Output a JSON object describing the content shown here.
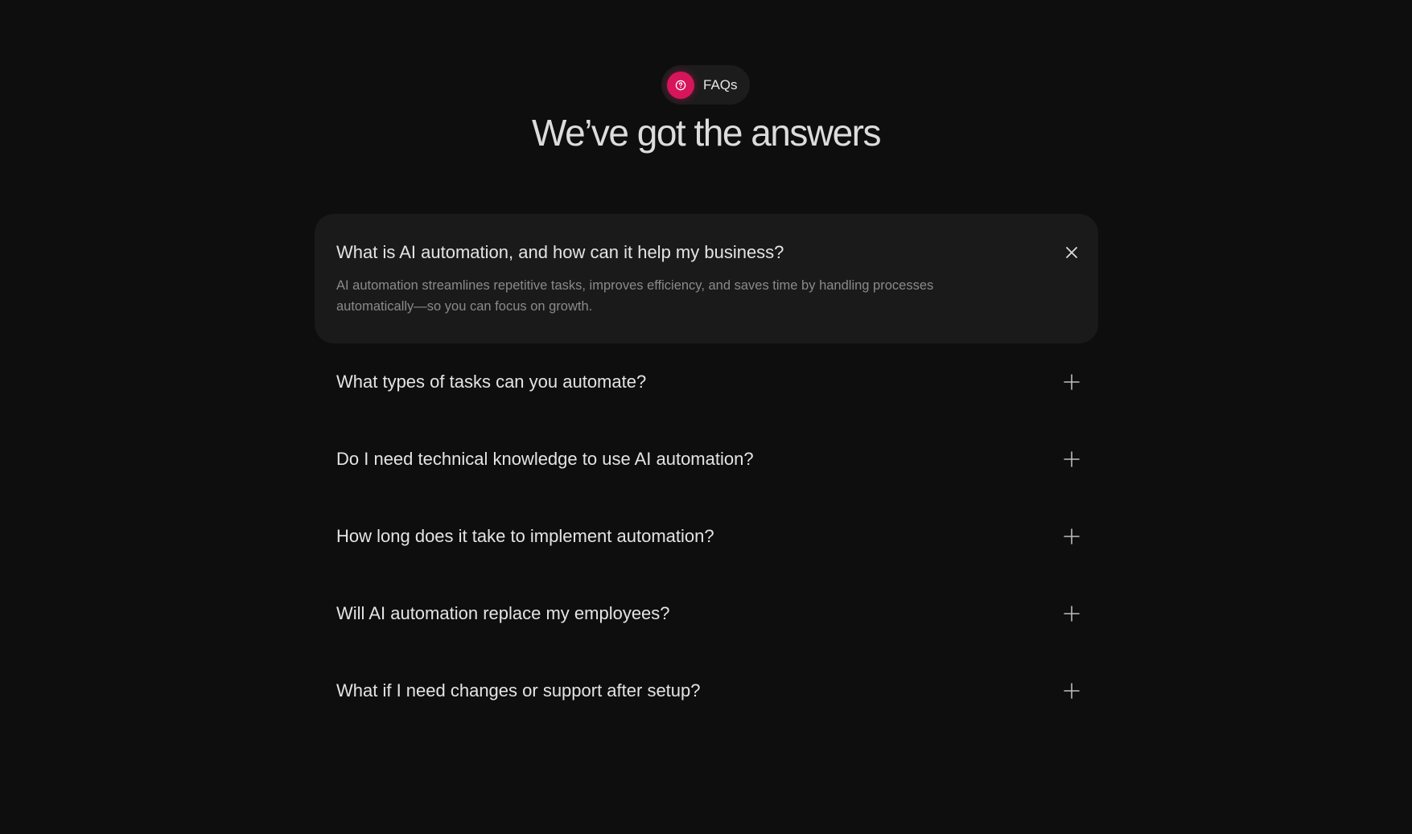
{
  "badge": {
    "label": "FAQs",
    "icon": "question-circle-icon",
    "accent_color": "#d6155a"
  },
  "heading": "We’ve got the answers",
  "faqs": [
    {
      "question": "What is AI automation, and how can it help my business?",
      "answer": "AI automation streamlines repetitive tasks, improves efficiency, and saves time by handling processes automatically—so you can focus on growth.",
      "expanded": true,
      "toggle_icon": "close-icon"
    },
    {
      "question": "What types of tasks can you automate?",
      "expanded": false,
      "toggle_icon": "plus-icon"
    },
    {
      "question": "Do I need technical knowledge to use AI automation?",
      "expanded": false,
      "toggle_icon": "plus-icon"
    },
    {
      "question": "How long does it take to implement automation?",
      "expanded": false,
      "toggle_icon": "plus-icon"
    },
    {
      "question": "Will AI automation replace my employees?",
      "expanded": false,
      "toggle_icon": "plus-icon"
    },
    {
      "question": "What if I need changes or support after setup?",
      "expanded": false,
      "toggle_icon": "plus-icon"
    }
  ]
}
